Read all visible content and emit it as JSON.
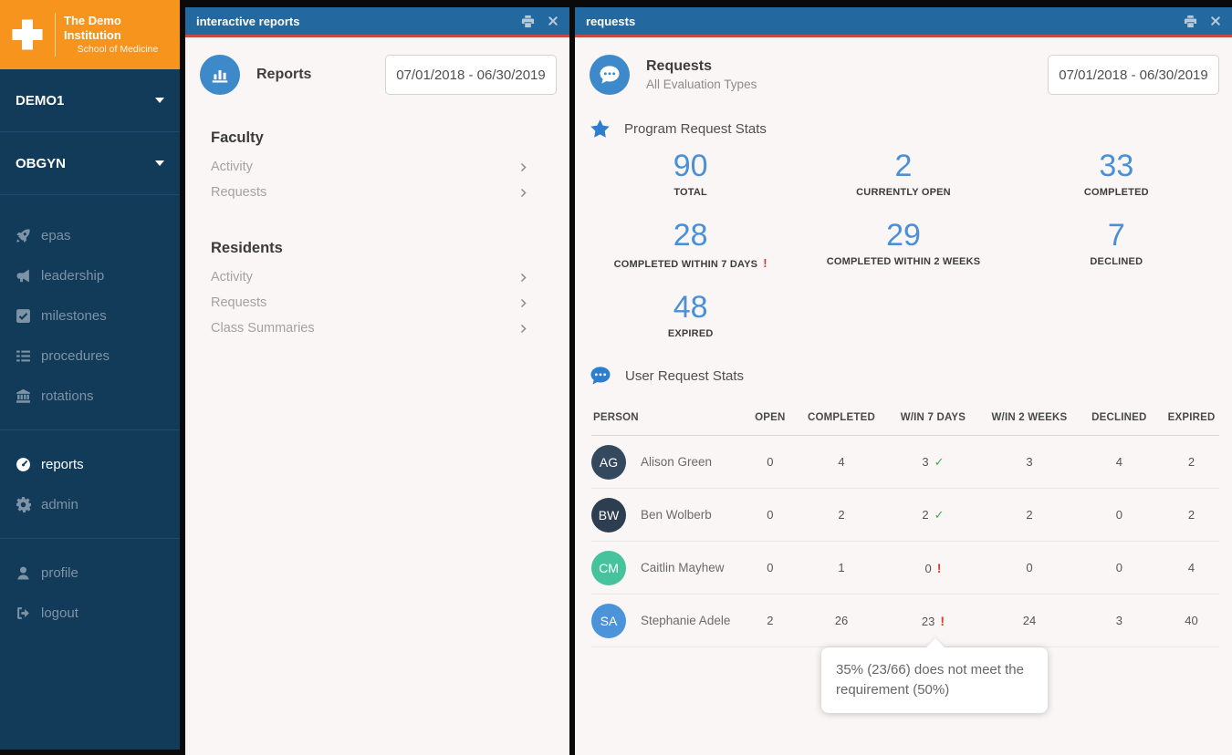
{
  "sidebar": {
    "logo": {
      "title": "The Demo Institution",
      "subtitle": "School of Medicine"
    },
    "org": {
      "label": "DEMO1"
    },
    "department": {
      "label": "OBGYN"
    },
    "nav": [
      {
        "icon": "rocket-icon",
        "label": "epas"
      },
      {
        "icon": "bullhorn-icon",
        "label": "leadership"
      },
      {
        "icon": "check-square-icon",
        "label": "milestones"
      },
      {
        "icon": "tasks-icon",
        "label": "procedures"
      },
      {
        "icon": "university-icon",
        "label": "rotations"
      }
    ],
    "nav_admin": [
      {
        "icon": "dashboard-icon",
        "label": "reports",
        "active": true
      },
      {
        "icon": "gear-icon",
        "label": "admin"
      }
    ],
    "nav_user": [
      {
        "icon": "user-icon",
        "label": "profile"
      },
      {
        "icon": "logout-icon",
        "label": "logout"
      }
    ]
  },
  "reports_panel": {
    "window_title": "interactive reports",
    "header": {
      "title": "Reports",
      "date_range": "07/01/2018 - 06/30/2019"
    },
    "groups": [
      {
        "heading": "Faculty",
        "items": [
          {
            "label": "Activity"
          },
          {
            "label": "Requests"
          }
        ]
      },
      {
        "heading": "Residents",
        "items": [
          {
            "label": "Activity"
          },
          {
            "label": "Requests"
          },
          {
            "label": "Class Summaries"
          }
        ]
      }
    ]
  },
  "requests_panel": {
    "window_title": "requests",
    "header": {
      "title": "Requests",
      "subtitle": "All Evaluation Types",
      "date_range": "07/01/2018 - 06/30/2019"
    },
    "program_stats": {
      "heading": "Program Request Stats",
      "stats": [
        {
          "value": "90",
          "label": "TOTAL"
        },
        {
          "value": "2",
          "label": "CURRENTLY OPEN"
        },
        {
          "value": "33",
          "label": "COMPLETED"
        },
        {
          "value": "28",
          "label": "COMPLETED WITHIN 7 DAYS",
          "alert_mark": "!"
        },
        {
          "value": "29",
          "label": "COMPLETED WITHIN 2 WEEKS"
        },
        {
          "value": "7",
          "label": "DECLINED"
        },
        {
          "value": "48",
          "label": "EXPIRED"
        }
      ]
    },
    "user_stats": {
      "heading": "User Request Stats",
      "columns": [
        "PERSON",
        "OPEN",
        "COMPLETED",
        "W/IN 7 DAYS",
        "W/IN 2 WEEKS",
        "DECLINED",
        "EXPIRED"
      ],
      "rows": [
        {
          "initials": "AG",
          "name": "Alison Green",
          "avatar_color": "#34495e",
          "open": "0",
          "completed": "4",
          "win7": "3",
          "flag_type": "check",
          "flag_mark": "✓",
          "win2w": "3",
          "declined": "4",
          "expired": "2"
        },
        {
          "initials": "BW",
          "name": "Ben Wolberb",
          "avatar_color": "#2d3e50",
          "open": "0",
          "completed": "2",
          "win7": "2",
          "flag_type": "check",
          "flag_mark": "✓",
          "win2w": "2",
          "declined": "0",
          "expired": "2"
        },
        {
          "initials": "CM",
          "name": "Caitlin Mayhew",
          "avatar_color": "#46c39c",
          "open": "0",
          "completed": "1",
          "win7": "0",
          "flag_type": "alert",
          "flag_mark": "!",
          "win2w": "0",
          "declined": "0",
          "expired": "4"
        },
        {
          "initials": "SA",
          "name": "Stephanie Adele",
          "avatar_color": "#4b94da",
          "open": "2",
          "completed": "26",
          "win7": "23",
          "flag_type": "alert",
          "flag_mark": "!",
          "win2w": "24",
          "declined": "3",
          "expired": "40"
        }
      ]
    },
    "tooltip": {
      "text": "35% (23/66) does not meet the requirement (50%)"
    }
  },
  "colors": {
    "accent_orange": "#f7941e",
    "sidebar_navy": "#123b59",
    "titlebar_blue": "#23689e",
    "titlebar_accent_red": "#c64a42",
    "stat_blue": "#4a90d9",
    "icon_circle_blue": "#3d89c9",
    "check_green": "#3fae41",
    "alert_red": "#e03a2f"
  }
}
